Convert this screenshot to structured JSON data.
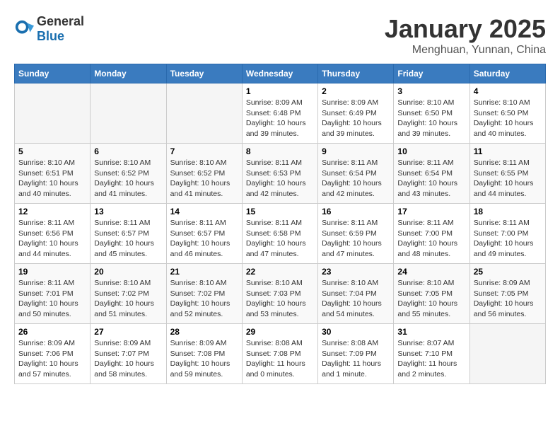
{
  "header": {
    "logo_general": "General",
    "logo_blue": "Blue",
    "month": "January 2025",
    "location": "Menghuan, Yunnan, China"
  },
  "days_of_week": [
    "Sunday",
    "Monday",
    "Tuesday",
    "Wednesday",
    "Thursday",
    "Friday",
    "Saturday"
  ],
  "weeks": [
    [
      {
        "day": "",
        "info": ""
      },
      {
        "day": "",
        "info": ""
      },
      {
        "day": "",
        "info": ""
      },
      {
        "day": "1",
        "info": "Sunrise: 8:09 AM\nSunset: 6:48 PM\nDaylight: 10 hours and 39 minutes."
      },
      {
        "day": "2",
        "info": "Sunrise: 8:09 AM\nSunset: 6:49 PM\nDaylight: 10 hours and 39 minutes."
      },
      {
        "day": "3",
        "info": "Sunrise: 8:10 AM\nSunset: 6:50 PM\nDaylight: 10 hours and 39 minutes."
      },
      {
        "day": "4",
        "info": "Sunrise: 8:10 AM\nSunset: 6:50 PM\nDaylight: 10 hours and 40 minutes."
      }
    ],
    [
      {
        "day": "5",
        "info": "Sunrise: 8:10 AM\nSunset: 6:51 PM\nDaylight: 10 hours and 40 minutes."
      },
      {
        "day": "6",
        "info": "Sunrise: 8:10 AM\nSunset: 6:52 PM\nDaylight: 10 hours and 41 minutes."
      },
      {
        "day": "7",
        "info": "Sunrise: 8:10 AM\nSunset: 6:52 PM\nDaylight: 10 hours and 41 minutes."
      },
      {
        "day": "8",
        "info": "Sunrise: 8:11 AM\nSunset: 6:53 PM\nDaylight: 10 hours and 42 minutes."
      },
      {
        "day": "9",
        "info": "Sunrise: 8:11 AM\nSunset: 6:54 PM\nDaylight: 10 hours and 42 minutes."
      },
      {
        "day": "10",
        "info": "Sunrise: 8:11 AM\nSunset: 6:54 PM\nDaylight: 10 hours and 43 minutes."
      },
      {
        "day": "11",
        "info": "Sunrise: 8:11 AM\nSunset: 6:55 PM\nDaylight: 10 hours and 44 minutes."
      }
    ],
    [
      {
        "day": "12",
        "info": "Sunrise: 8:11 AM\nSunset: 6:56 PM\nDaylight: 10 hours and 44 minutes."
      },
      {
        "day": "13",
        "info": "Sunrise: 8:11 AM\nSunset: 6:57 PM\nDaylight: 10 hours and 45 minutes."
      },
      {
        "day": "14",
        "info": "Sunrise: 8:11 AM\nSunset: 6:57 PM\nDaylight: 10 hours and 46 minutes."
      },
      {
        "day": "15",
        "info": "Sunrise: 8:11 AM\nSunset: 6:58 PM\nDaylight: 10 hours and 47 minutes."
      },
      {
        "day": "16",
        "info": "Sunrise: 8:11 AM\nSunset: 6:59 PM\nDaylight: 10 hours and 47 minutes."
      },
      {
        "day": "17",
        "info": "Sunrise: 8:11 AM\nSunset: 7:00 PM\nDaylight: 10 hours and 48 minutes."
      },
      {
        "day": "18",
        "info": "Sunrise: 8:11 AM\nSunset: 7:00 PM\nDaylight: 10 hours and 49 minutes."
      }
    ],
    [
      {
        "day": "19",
        "info": "Sunrise: 8:11 AM\nSunset: 7:01 PM\nDaylight: 10 hours and 50 minutes."
      },
      {
        "day": "20",
        "info": "Sunrise: 8:10 AM\nSunset: 7:02 PM\nDaylight: 10 hours and 51 minutes."
      },
      {
        "day": "21",
        "info": "Sunrise: 8:10 AM\nSunset: 7:02 PM\nDaylight: 10 hours and 52 minutes."
      },
      {
        "day": "22",
        "info": "Sunrise: 8:10 AM\nSunset: 7:03 PM\nDaylight: 10 hours and 53 minutes."
      },
      {
        "day": "23",
        "info": "Sunrise: 8:10 AM\nSunset: 7:04 PM\nDaylight: 10 hours and 54 minutes."
      },
      {
        "day": "24",
        "info": "Sunrise: 8:10 AM\nSunset: 7:05 PM\nDaylight: 10 hours and 55 minutes."
      },
      {
        "day": "25",
        "info": "Sunrise: 8:09 AM\nSunset: 7:05 PM\nDaylight: 10 hours and 56 minutes."
      }
    ],
    [
      {
        "day": "26",
        "info": "Sunrise: 8:09 AM\nSunset: 7:06 PM\nDaylight: 10 hours and 57 minutes."
      },
      {
        "day": "27",
        "info": "Sunrise: 8:09 AM\nSunset: 7:07 PM\nDaylight: 10 hours and 58 minutes."
      },
      {
        "day": "28",
        "info": "Sunrise: 8:09 AM\nSunset: 7:08 PM\nDaylight: 10 hours and 59 minutes."
      },
      {
        "day": "29",
        "info": "Sunrise: 8:08 AM\nSunset: 7:08 PM\nDaylight: 11 hours and 0 minutes."
      },
      {
        "day": "30",
        "info": "Sunrise: 8:08 AM\nSunset: 7:09 PM\nDaylight: 11 hours and 1 minute."
      },
      {
        "day": "31",
        "info": "Sunrise: 8:07 AM\nSunset: 7:10 PM\nDaylight: 11 hours and 2 minutes."
      },
      {
        "day": "",
        "info": ""
      }
    ]
  ]
}
